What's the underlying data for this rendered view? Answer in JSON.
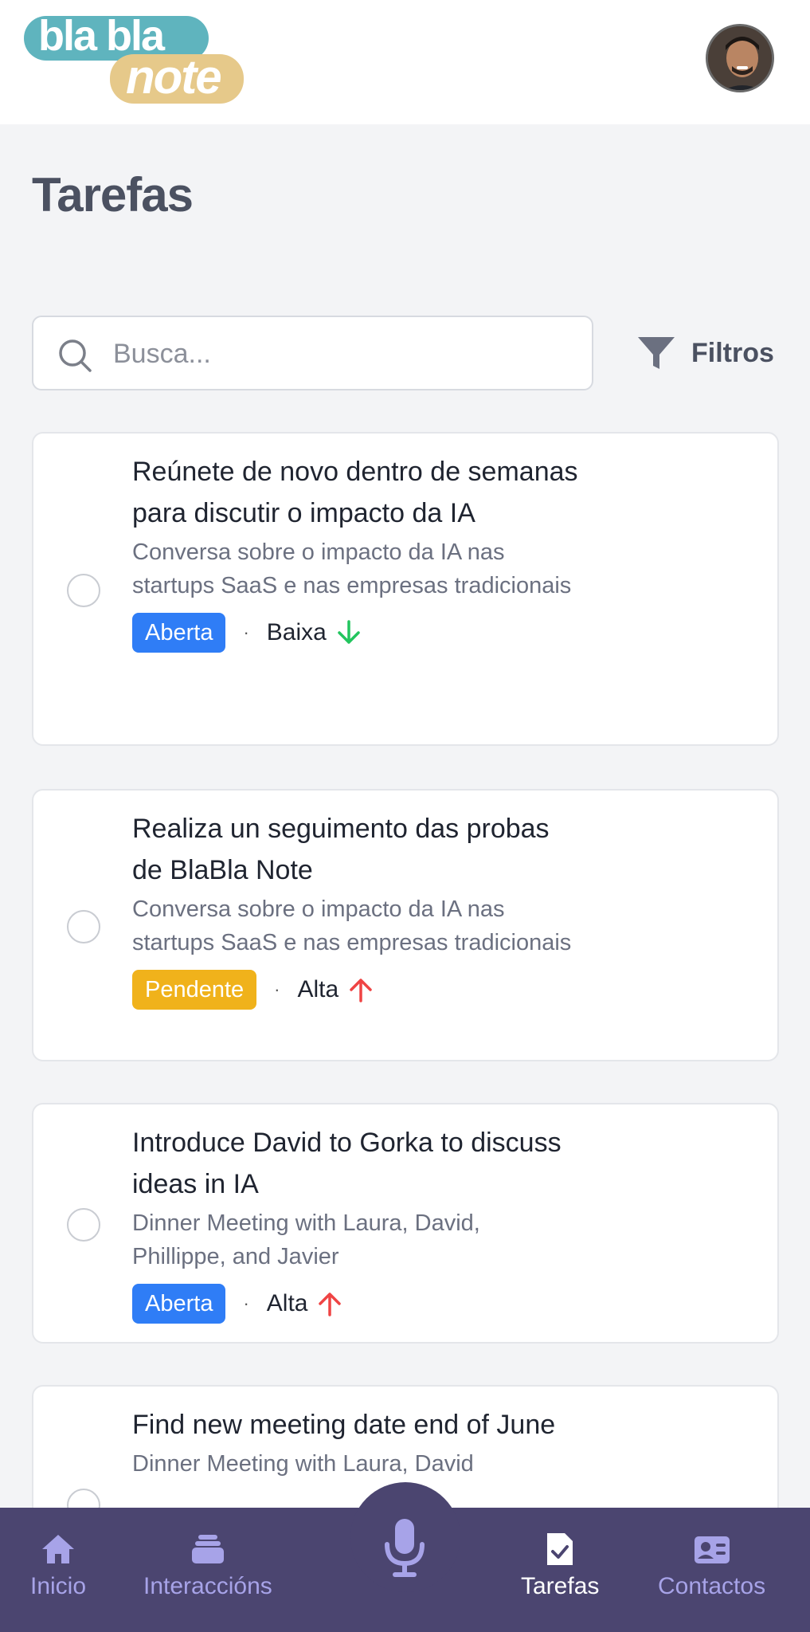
{
  "header": {
    "logo_top": "bla bla",
    "logo_bottom": "note"
  },
  "page": {
    "title": "Tarefas"
  },
  "search": {
    "placeholder": "Busca..."
  },
  "filters": {
    "label": "Filtros"
  },
  "tasks": [
    {
      "title": "Reúnete de novo dentro de semanas para discutir o impacto da IA",
      "description": "Conversa sobre o impacto da IA nas startups SaaS e nas empresas tradicionais",
      "status": "Aberta",
      "priority": "Baixa"
    },
    {
      "title": "Realiza un seguimento das probas de BlaBla Note",
      "description": "Conversa sobre o impacto da IA nas startups SaaS e nas empresas tradicionais",
      "status": "Pendente",
      "priority": "Alta"
    },
    {
      "title": "Introduce David to Gorka to discuss ideas in IA",
      "description": "Dinner Meeting with Laura, David, Phillippe, and Javier",
      "status": "Aberta",
      "priority": "Alta"
    },
    {
      "title": "Find new meeting date end of June",
      "description": "Dinner Meeting with Laura, David"
    }
  ],
  "nav": {
    "items": [
      {
        "label": "Inicio",
        "icon": "home-icon"
      },
      {
        "label": "Interaccións",
        "icon": "stack-icon"
      },
      {
        "label": "",
        "icon": "microphone-icon"
      },
      {
        "label": "Tarefas",
        "icon": "task-icon",
        "active": true
      },
      {
        "label": "Contactos",
        "icon": "contact-card-icon"
      }
    ]
  },
  "colors": {
    "status_open": "#2f7df6",
    "status_pending": "#f0b21b",
    "priority_low": "#22c55e",
    "priority_high": "#ef4444",
    "nav_background": "#4b4570",
    "nav_inactive": "#a7a3e8"
  }
}
